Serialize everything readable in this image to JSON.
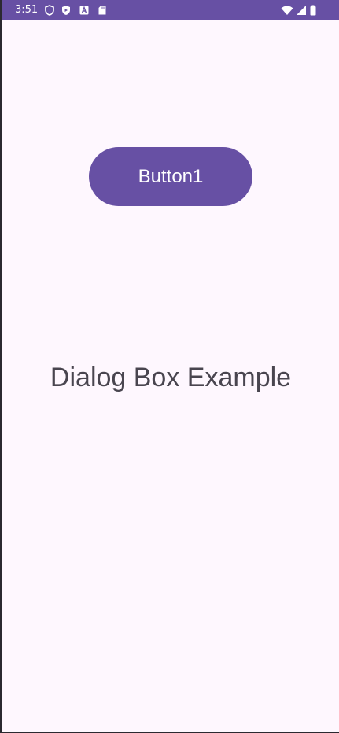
{
  "status_bar": {
    "time": "3:51",
    "left_icons": [
      "shield-icon",
      "play-protect-icon",
      "font-icon",
      "sd-card-icon"
    ],
    "right_icons": [
      "wifi-icon",
      "cellular-signal-icon",
      "battery-icon"
    ],
    "background_color": "#6750a4"
  },
  "main": {
    "button_label": "Button1",
    "label_text": "Dialog Box Example"
  },
  "colors": {
    "background": "#fef7fe",
    "accent": "#6750a4",
    "text": "#49454f"
  }
}
